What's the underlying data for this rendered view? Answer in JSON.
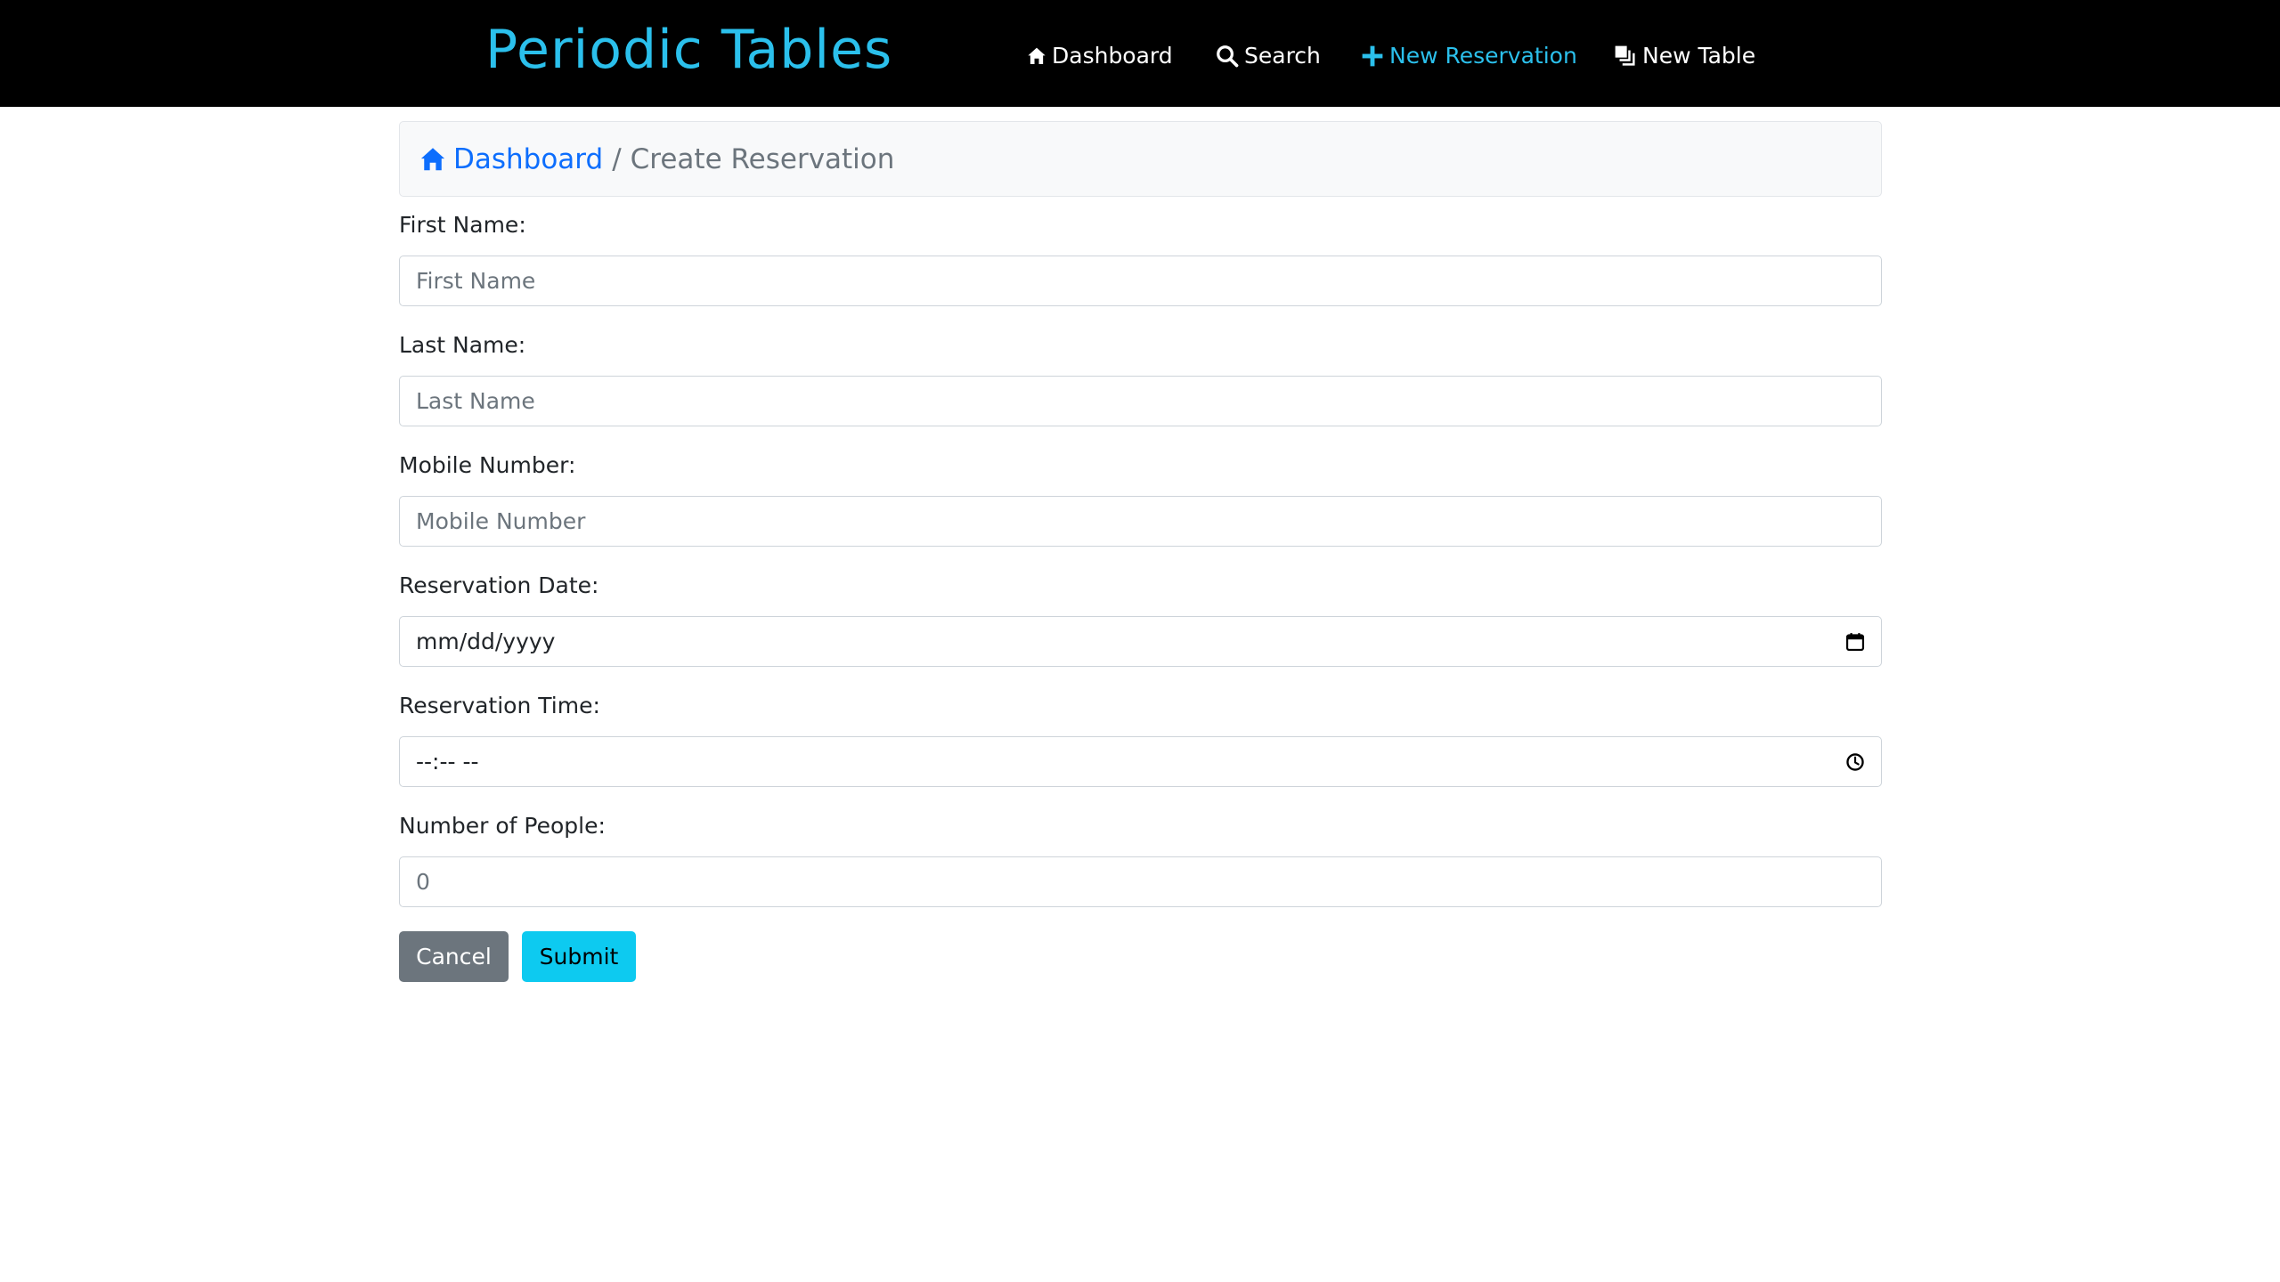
{
  "app": {
    "brand": "Periodic Tables"
  },
  "nav": {
    "dashboard": "Dashboard",
    "search": "Search",
    "new_reservation": "New Reservation",
    "new_table": "New Table"
  },
  "breadcrumb": {
    "home": "Dashboard",
    "separator": "/",
    "current": "Create Reservation"
  },
  "form": {
    "first_name": {
      "label": "First Name:",
      "placeholder": "First Name",
      "value": ""
    },
    "last_name": {
      "label": "Last Name:",
      "placeholder": "Last Name",
      "value": ""
    },
    "mobile": {
      "label": "Mobile Number:",
      "placeholder": "Mobile Number",
      "value": ""
    },
    "date": {
      "label": "Reservation Date:",
      "placeholder": "mm/dd/yyyy",
      "icon": "calendar-icon"
    },
    "time": {
      "label": "Reservation Time:",
      "placeholder": "--:-- --",
      "icon": "clock-icon"
    },
    "people": {
      "label": "Number of People:",
      "value": "0"
    }
  },
  "buttons": {
    "cancel": "Cancel",
    "submit": "Submit"
  },
  "colors": {
    "brand": "#2bc0ec",
    "active_nav": "#2bc0ec",
    "link": "#0d6efd",
    "cancel_bg": "#6c757d",
    "submit_bg": "#0dcaf0",
    "topbar_bg": "#000000"
  },
  "icons": {
    "nav_dashboard": "home-icon",
    "nav_search": "search-icon",
    "nav_new_reservation": "plus-icon",
    "nav_new_table": "table-icon",
    "breadcrumb_home": "home-icon"
  }
}
